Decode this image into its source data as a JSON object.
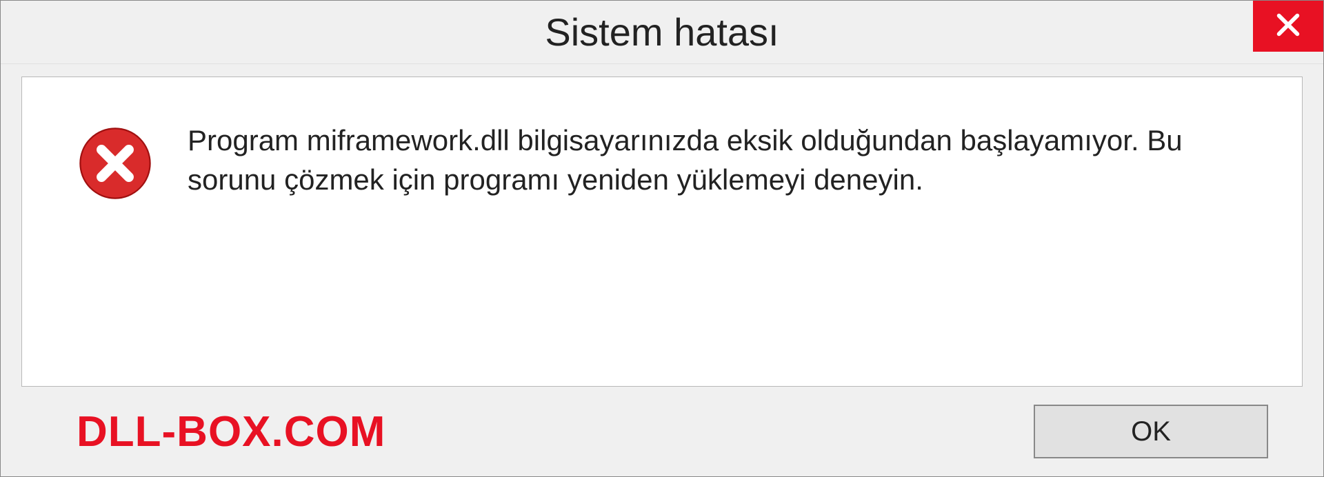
{
  "titlebar": {
    "title": "Sistem hatası"
  },
  "icons": {
    "close": "close-icon",
    "error": "error-icon"
  },
  "content": {
    "message": "Program miframework.dll bilgisayarınızda eksik olduğundan başlayamıyor. Bu sorunu çözmek için programı yeniden yüklemeyi deneyin."
  },
  "footer": {
    "watermark": "DLL-BOX.COM",
    "ok_label": "OK"
  },
  "colors": {
    "close_bg": "#e81123",
    "error_bg": "#d92b2b",
    "watermark": "#e81123"
  }
}
